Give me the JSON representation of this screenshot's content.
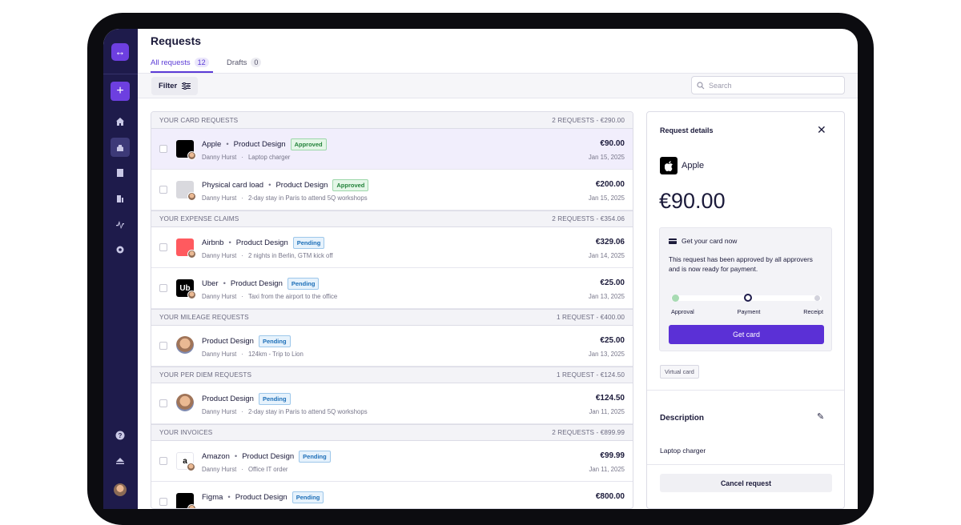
{
  "app": {
    "logo_glyph": "↔",
    "add_glyph": "+"
  },
  "page": {
    "title": "Requests"
  },
  "tabs": [
    {
      "label": "All requests",
      "count": "12"
    },
    {
      "label": "Drafts",
      "count": "0"
    }
  ],
  "toolbar": {
    "filter_label": "Filter",
    "search_placeholder": "Search"
  },
  "sections": [
    {
      "title": "YOUR CARD REQUESTS",
      "summary": "2 REQUESTS - €290.00",
      "rows": [
        {
          "merchant": "Apple",
          "category": "Product Design",
          "status": "Approved",
          "requester": "Danny Hurst",
          "note": "Laptop charger",
          "amount": "€90.00",
          "date": "Jan 15, 2025",
          "logo": "",
          "logo_color": "#000000",
          "selected": true
        },
        {
          "merchant": "Physical card load",
          "category": "Product Design",
          "status": "Approved",
          "requester": "Danny Hurst",
          "note": "2-day stay in Paris to attend 5Q workshops",
          "amount": "€200.00",
          "date": "Jan 15, 2025",
          "logo": "",
          "logo_color": "#d9d9de",
          "selected": false
        }
      ]
    },
    {
      "title": "YOUR EXPENSE CLAIMS",
      "summary": "2 REQUESTS - €354.06",
      "rows": [
        {
          "merchant": "Airbnb",
          "category": "Product Design",
          "status": "Pending",
          "requester": "Danny Hurst",
          "note": "2 nights in Berlin, GTM kick off",
          "amount": "€329.06",
          "date": "Jan 14, 2025",
          "logo": "",
          "logo_color": "#ff5a5f"
        },
        {
          "merchant": "Uber",
          "category": "Product Design",
          "status": "Pending",
          "requester": "Danny Hurst",
          "note": "Taxi from the airport to the office",
          "amount": "€25.00",
          "date": "Jan 13, 2025",
          "logo": "Ub",
          "logo_color": "#000000"
        }
      ]
    },
    {
      "title": "YOUR MILEAGE REQUESTS",
      "summary": "1 REQUEST - €400.00",
      "rows": [
        {
          "merchant": "",
          "category": "Product Design",
          "status": "Pending",
          "requester": "Danny Hurst",
          "note": "124km - Trip to Lion",
          "amount": "€25.00",
          "date": "Jan 13, 2025",
          "face": true
        }
      ]
    },
    {
      "title": "YOUR PER DIEM REQUESTS",
      "summary": "1 REQUEST - €124.50",
      "rows": [
        {
          "merchant": "",
          "category": "Product Design",
          "status": "Pending",
          "requester": "Danny Hurst",
          "note": "2-day stay in Paris to attend 5Q workshops",
          "amount": "€124.50",
          "date": "Jan 11, 2025",
          "face": true
        }
      ]
    },
    {
      "title": "YOUR INVOICES",
      "summary": "2 REQUESTS - €899.99",
      "rows": [
        {
          "merchant": "Amazon",
          "category": "Product Design",
          "status": "Pending",
          "requester": "Danny Hurst",
          "note": "Office IT order",
          "amount": "€99.99",
          "date": "Jan 11, 2025",
          "logo": "a",
          "logo_color": "#ffffff",
          "logo_text_color": "#000000"
        },
        {
          "merchant": "Figma",
          "category": "Product Design",
          "status": "Pending",
          "requester": "",
          "note": "",
          "amount": "€800.00",
          "date": "",
          "logo": "",
          "logo_color": "#000000"
        }
      ]
    }
  ],
  "details": {
    "title": "Request details",
    "merchant": "Apple",
    "amount": "€90.00",
    "card_title": "Get your card now",
    "card_message": "This request has been approved by all approvers and is now ready for payment.",
    "steps": [
      "Approval",
      "Payment",
      "Receipt"
    ],
    "progress_step": 2,
    "get_card_label": "Get card",
    "tag": "Virtual card",
    "description_title": "Description",
    "description": "Laptop charger",
    "cancel_label": "Cancel request"
  },
  "colors": {
    "accent": "#5b30d6",
    "sidebar": "#1e1b4b",
    "approved": "#23823a",
    "pending": "#1d6fb8"
  }
}
